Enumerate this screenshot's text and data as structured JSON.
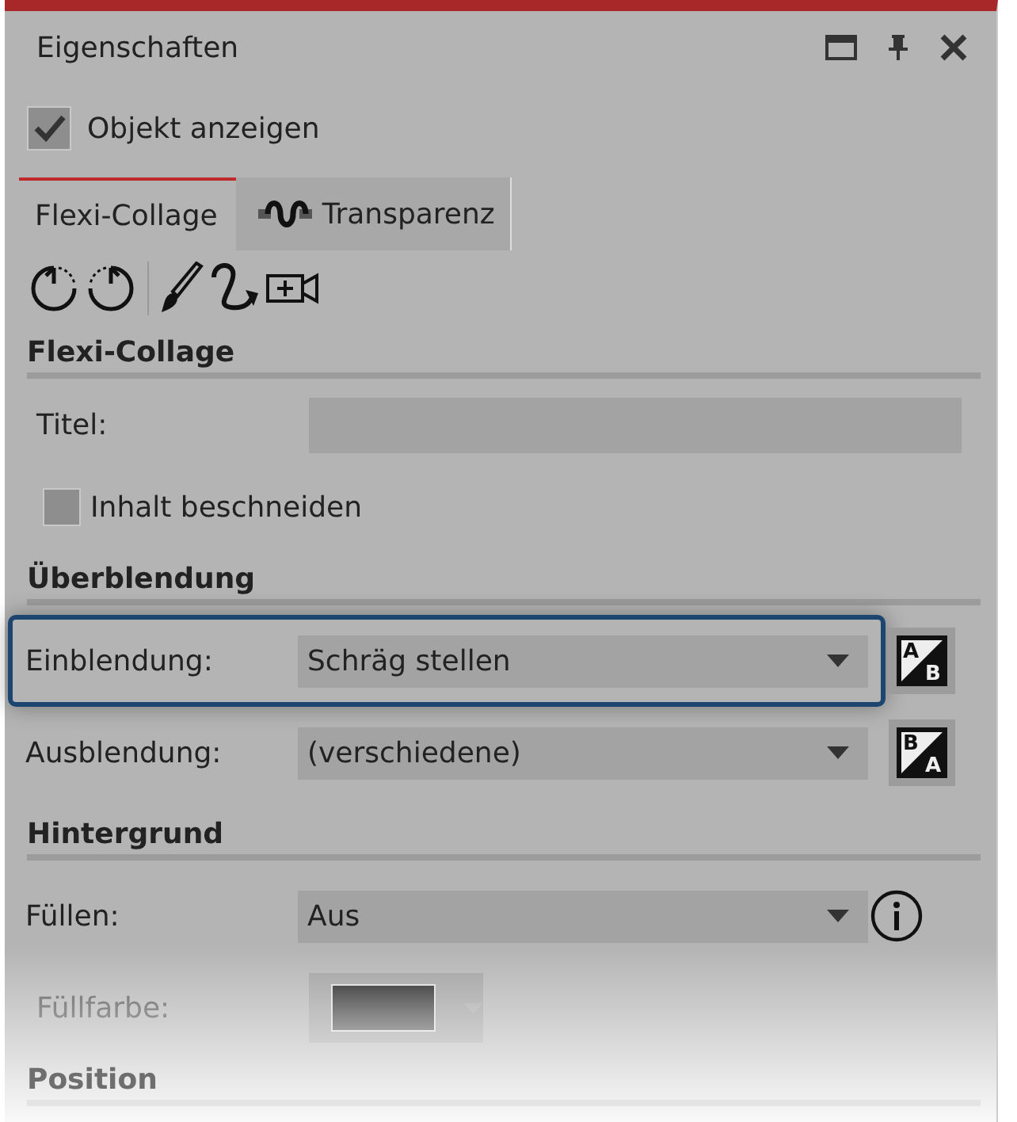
{
  "panel": {
    "title": "Eigenschaften"
  },
  "show_object": {
    "label": "Objekt anzeigen",
    "checked": true
  },
  "tabs": [
    {
      "label": "Flexi-Collage",
      "selected": true
    },
    {
      "label": "Transparenz",
      "selected": false
    }
  ],
  "sections": [
    {
      "heading": "Flexi-Collage",
      "rows": [
        {
          "kind": "text",
          "label": "Titel:"
        },
        {
          "kind": "checkbox",
          "label": "Inhalt beschneiden",
          "checked": false
        }
      ]
    },
    {
      "heading": "Überblendung",
      "rows": [
        {
          "kind": "select",
          "label": "Einblendung:",
          "value": "Schräg stellen",
          "button_letters": [
            "A",
            "B"
          ],
          "focused": true
        },
        {
          "kind": "select",
          "label": "Ausblendung:",
          "value": "(verschiedene)",
          "button_letters": [
            "B",
            "A"
          ],
          "focused": false
        }
      ]
    },
    {
      "heading": "Hintergrund",
      "rows": [
        {
          "kind": "select",
          "label": "Füllen:",
          "value": "Aus",
          "info": true,
          "focused": false
        },
        {
          "kind": "color",
          "label": "Füllfarbe:",
          "disabled": true
        }
      ]
    },
    {
      "heading": "Position"
    }
  ]
}
